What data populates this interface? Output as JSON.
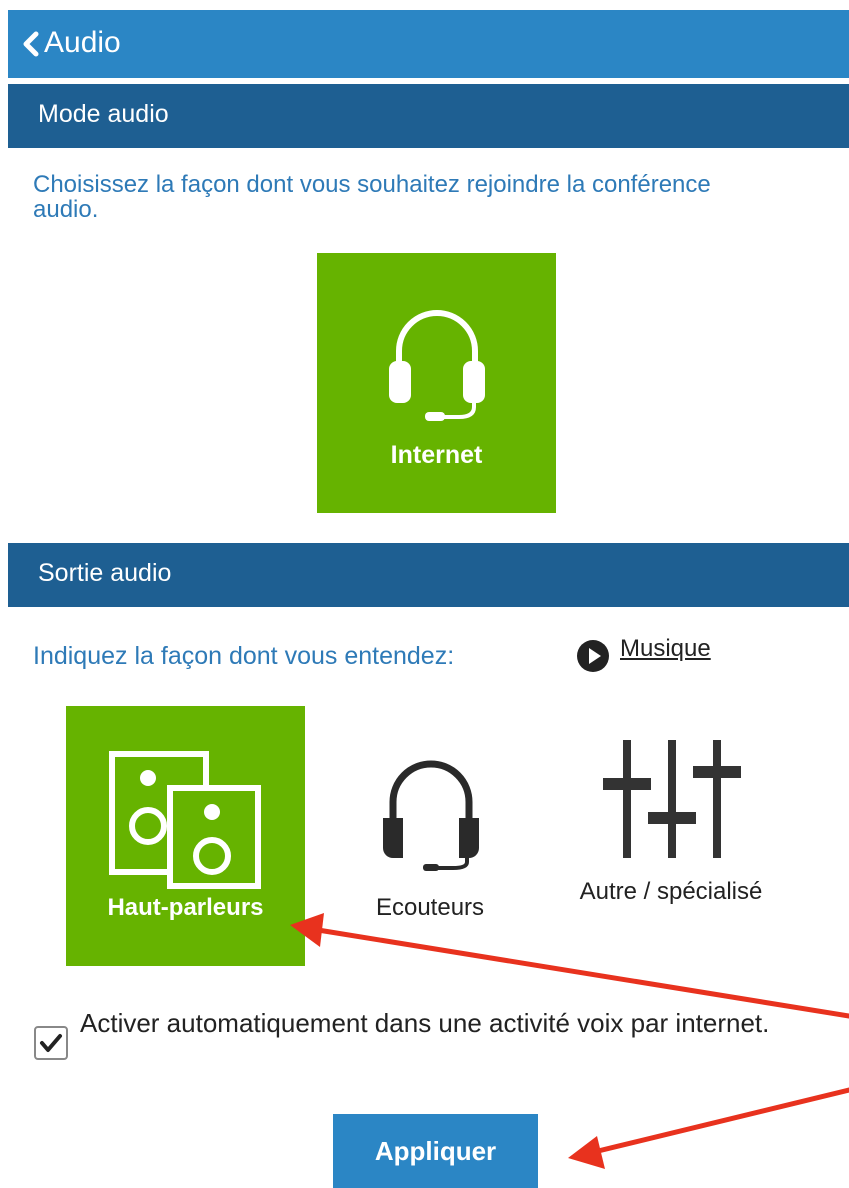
{
  "header": {
    "back_icon": "chevron-left-icon",
    "title": "Audio"
  },
  "mode_section": {
    "title": "Mode audio",
    "intro": "Choisissez la façon dont vous souhaitez rejoindre la conférence audio.",
    "options": [
      {
        "label": "Internet",
        "icon": "headset-icon",
        "selected": true
      }
    ]
  },
  "output_section": {
    "title": "Sortie audio",
    "instruction": "Indiquez la façon dont vous entendez:",
    "music_icon": "play-icon",
    "music_link": "Musique",
    "options": [
      {
        "label": "Haut-parleurs",
        "icon": "speakers-icon",
        "selected": true
      },
      {
        "label": "Ecouteurs",
        "icon": "headphones-icon",
        "selected": false
      },
      {
        "label": "Autre / spécialisé",
        "icon": "equalizer-icon",
        "selected": false
      }
    ]
  },
  "auto_enable": {
    "checked": true,
    "label": "Activer automatiquement dans une activité voix par internet."
  },
  "apply_button": {
    "label": "Appliquer"
  },
  "colors": {
    "header_blue": "#2b86c5",
    "section_blue": "#1e5f92",
    "selected_green": "#66b300",
    "text_blue": "#2e7ab7",
    "annotation_red": "#e8321e"
  }
}
